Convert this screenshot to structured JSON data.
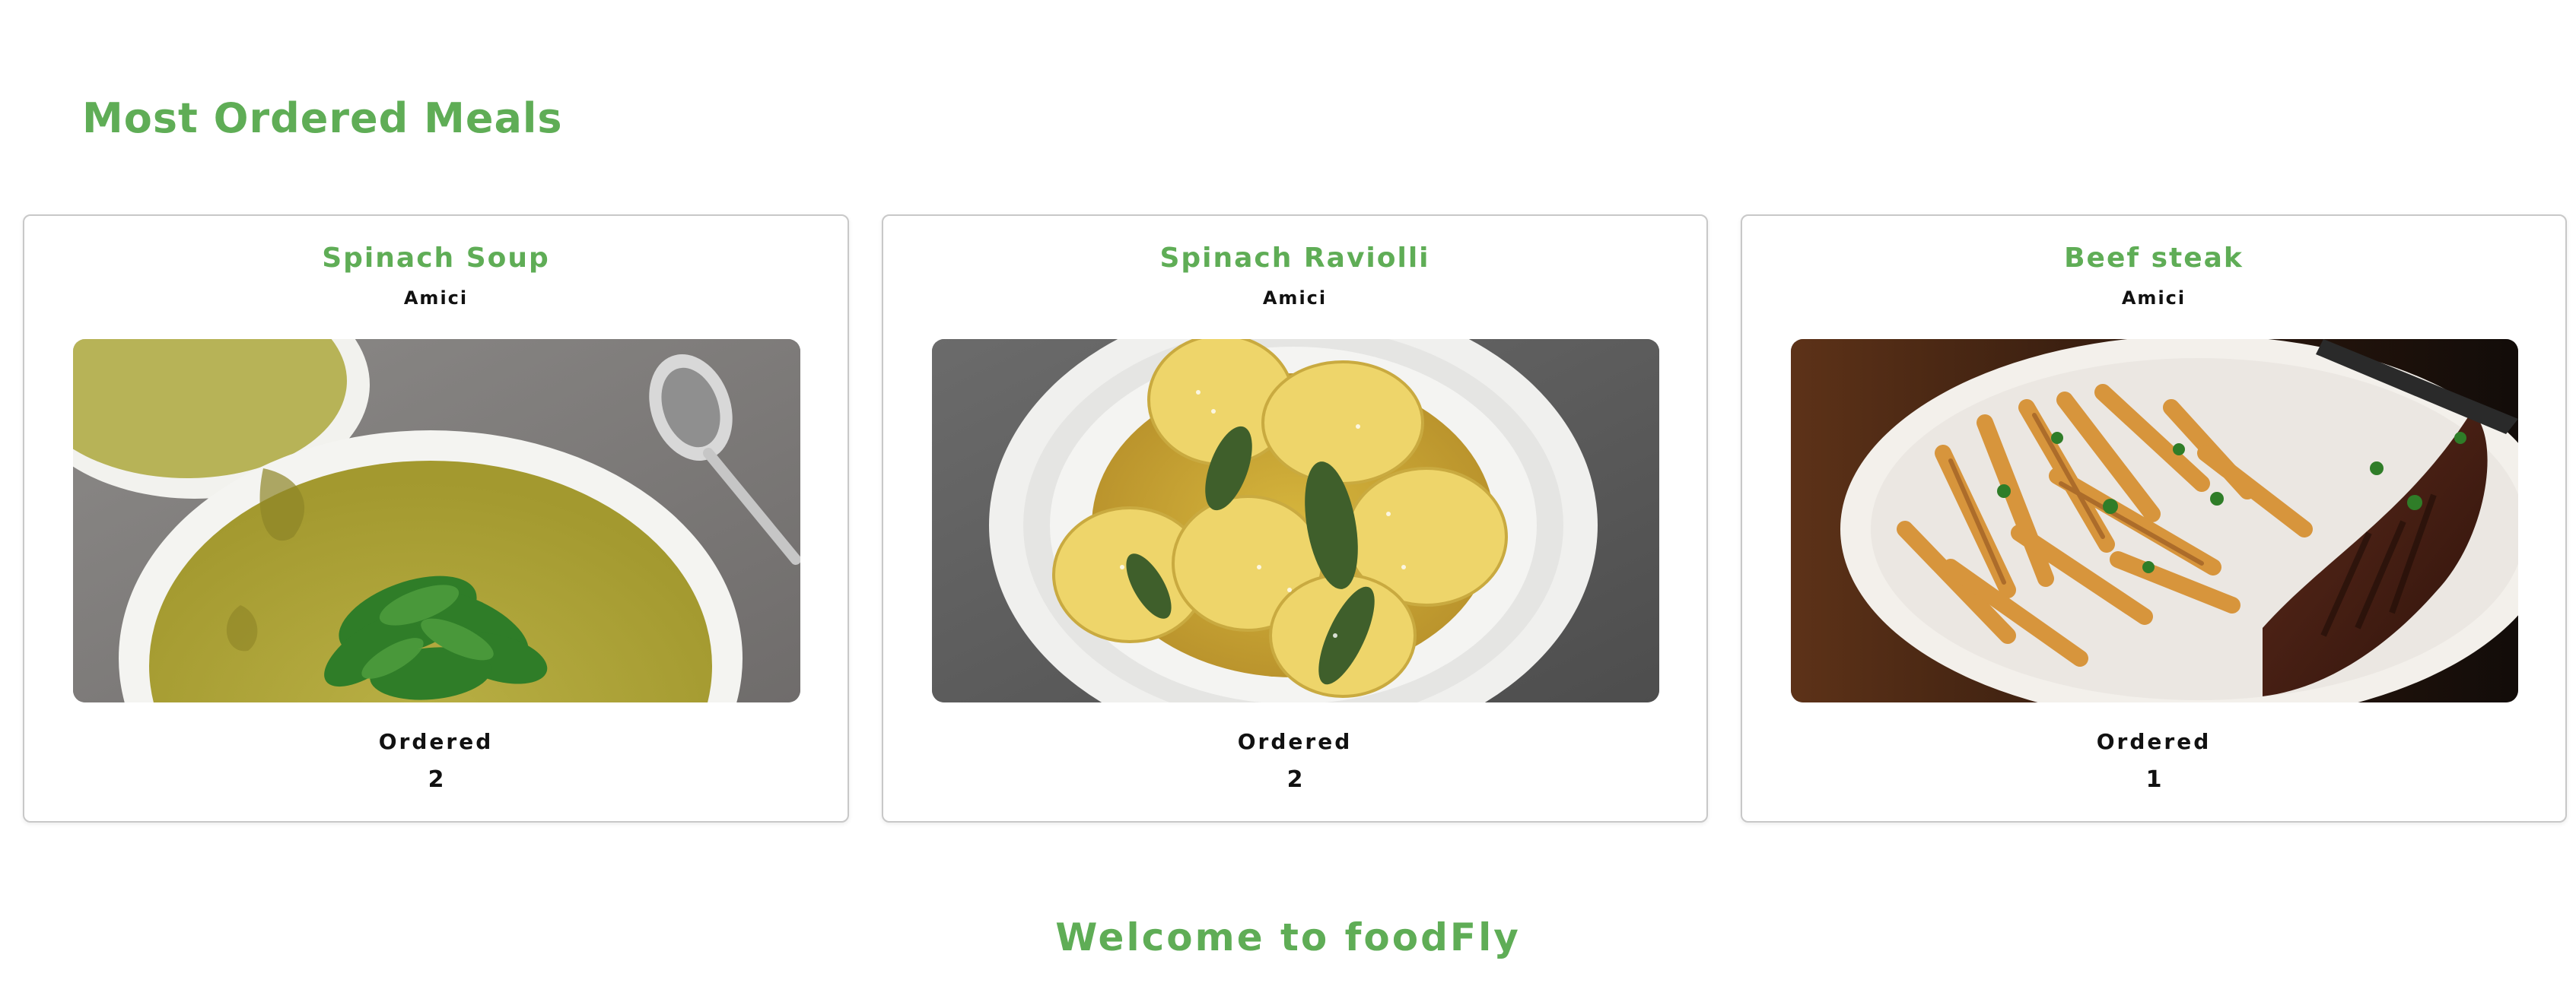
{
  "section": {
    "title": "Most Ordered Meals"
  },
  "meals": [
    {
      "name": "Spinach Soup",
      "restaurant": "Amici",
      "ordered_label": "Ordered",
      "ordered_count": "2",
      "image_alt": "Spinach soup in white bowl with greens and spoon"
    },
    {
      "name": "Spinach Raviolli",
      "restaurant": "Amici",
      "ordered_label": "Ordered",
      "ordered_count": "2",
      "image_alt": "Spinach ravioli on white plate with sauce and herbs"
    },
    {
      "name": "Beef steak",
      "restaurant": "Amici",
      "ordered_label": "Ordered",
      "ordered_count": "1",
      "image_alt": "Beef steak with fries on white plate"
    }
  ],
  "footer": {
    "welcome": "Welcome to foodFly"
  },
  "colors": {
    "accent": "#5fad56",
    "text": "#111111",
    "card_border": "#c8c8c8"
  }
}
